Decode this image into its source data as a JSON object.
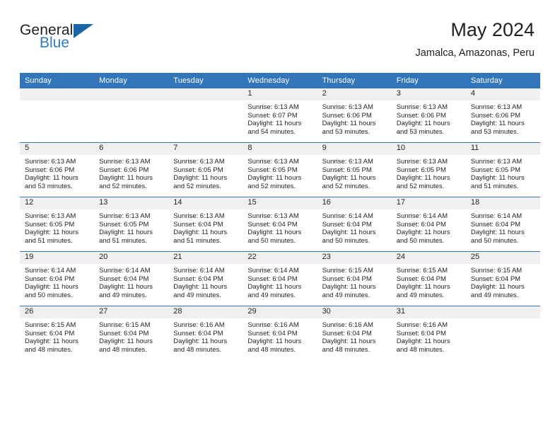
{
  "brand": {
    "word_general": "General",
    "word_blue": "Blue",
    "accent_color": "#2e7cc4",
    "triangle_color": "#1565a8"
  },
  "header": {
    "title": "May 2024",
    "subtitle": "Jamalca, Amazonas, Peru",
    "header_bg": "#3275b8",
    "daynum_band_bg": "#f0f0f0"
  },
  "weekdays": [
    "Sunday",
    "Monday",
    "Tuesday",
    "Wednesday",
    "Thursday",
    "Friday",
    "Saturday"
  ],
  "weeks": [
    [
      {
        "day": "",
        "sunrise": "",
        "sunset": "",
        "daylight1": "",
        "daylight2": ""
      },
      {
        "day": "",
        "sunrise": "",
        "sunset": "",
        "daylight1": "",
        "daylight2": ""
      },
      {
        "day": "",
        "sunrise": "",
        "sunset": "",
        "daylight1": "",
        "daylight2": ""
      },
      {
        "day": "1",
        "sunrise": "Sunrise: 6:13 AM",
        "sunset": "Sunset: 6:07 PM",
        "daylight1": "Daylight: 11 hours",
        "daylight2": "and 54 minutes."
      },
      {
        "day": "2",
        "sunrise": "Sunrise: 6:13 AM",
        "sunset": "Sunset: 6:06 PM",
        "daylight1": "Daylight: 11 hours",
        "daylight2": "and 53 minutes."
      },
      {
        "day": "3",
        "sunrise": "Sunrise: 6:13 AM",
        "sunset": "Sunset: 6:06 PM",
        "daylight1": "Daylight: 11 hours",
        "daylight2": "and 53 minutes."
      },
      {
        "day": "4",
        "sunrise": "Sunrise: 6:13 AM",
        "sunset": "Sunset: 6:06 PM",
        "daylight1": "Daylight: 11 hours",
        "daylight2": "and 53 minutes."
      }
    ],
    [
      {
        "day": "5",
        "sunrise": "Sunrise: 6:13 AM",
        "sunset": "Sunset: 6:06 PM",
        "daylight1": "Daylight: 11 hours",
        "daylight2": "and 53 minutes."
      },
      {
        "day": "6",
        "sunrise": "Sunrise: 6:13 AM",
        "sunset": "Sunset: 6:06 PM",
        "daylight1": "Daylight: 11 hours",
        "daylight2": "and 52 minutes."
      },
      {
        "day": "7",
        "sunrise": "Sunrise: 6:13 AM",
        "sunset": "Sunset: 6:05 PM",
        "daylight1": "Daylight: 11 hours",
        "daylight2": "and 52 minutes."
      },
      {
        "day": "8",
        "sunrise": "Sunrise: 6:13 AM",
        "sunset": "Sunset: 6:05 PM",
        "daylight1": "Daylight: 11 hours",
        "daylight2": "and 52 minutes."
      },
      {
        "day": "9",
        "sunrise": "Sunrise: 6:13 AM",
        "sunset": "Sunset: 6:05 PM",
        "daylight1": "Daylight: 11 hours",
        "daylight2": "and 52 minutes."
      },
      {
        "day": "10",
        "sunrise": "Sunrise: 6:13 AM",
        "sunset": "Sunset: 6:05 PM",
        "daylight1": "Daylight: 11 hours",
        "daylight2": "and 52 minutes."
      },
      {
        "day": "11",
        "sunrise": "Sunrise: 6:13 AM",
        "sunset": "Sunset: 6:05 PM",
        "daylight1": "Daylight: 11 hours",
        "daylight2": "and 51 minutes."
      }
    ],
    [
      {
        "day": "12",
        "sunrise": "Sunrise: 6:13 AM",
        "sunset": "Sunset: 6:05 PM",
        "daylight1": "Daylight: 11 hours",
        "daylight2": "and 51 minutes."
      },
      {
        "day": "13",
        "sunrise": "Sunrise: 6:13 AM",
        "sunset": "Sunset: 6:05 PM",
        "daylight1": "Daylight: 11 hours",
        "daylight2": "and 51 minutes."
      },
      {
        "day": "14",
        "sunrise": "Sunrise: 6:13 AM",
        "sunset": "Sunset: 6:04 PM",
        "daylight1": "Daylight: 11 hours",
        "daylight2": "and 51 minutes."
      },
      {
        "day": "15",
        "sunrise": "Sunrise: 6:13 AM",
        "sunset": "Sunset: 6:04 PM",
        "daylight1": "Daylight: 11 hours",
        "daylight2": "and 50 minutes."
      },
      {
        "day": "16",
        "sunrise": "Sunrise: 6:14 AM",
        "sunset": "Sunset: 6:04 PM",
        "daylight1": "Daylight: 11 hours",
        "daylight2": "and 50 minutes."
      },
      {
        "day": "17",
        "sunrise": "Sunrise: 6:14 AM",
        "sunset": "Sunset: 6:04 PM",
        "daylight1": "Daylight: 11 hours",
        "daylight2": "and 50 minutes."
      },
      {
        "day": "18",
        "sunrise": "Sunrise: 6:14 AM",
        "sunset": "Sunset: 6:04 PM",
        "daylight1": "Daylight: 11 hours",
        "daylight2": "and 50 minutes."
      }
    ],
    [
      {
        "day": "19",
        "sunrise": "Sunrise: 6:14 AM",
        "sunset": "Sunset: 6:04 PM",
        "daylight1": "Daylight: 11 hours",
        "daylight2": "and 50 minutes."
      },
      {
        "day": "20",
        "sunrise": "Sunrise: 6:14 AM",
        "sunset": "Sunset: 6:04 PM",
        "daylight1": "Daylight: 11 hours",
        "daylight2": "and 49 minutes."
      },
      {
        "day": "21",
        "sunrise": "Sunrise: 6:14 AM",
        "sunset": "Sunset: 6:04 PM",
        "daylight1": "Daylight: 11 hours",
        "daylight2": "and 49 minutes."
      },
      {
        "day": "22",
        "sunrise": "Sunrise: 6:14 AM",
        "sunset": "Sunset: 6:04 PM",
        "daylight1": "Daylight: 11 hours",
        "daylight2": "and 49 minutes."
      },
      {
        "day": "23",
        "sunrise": "Sunrise: 6:15 AM",
        "sunset": "Sunset: 6:04 PM",
        "daylight1": "Daylight: 11 hours",
        "daylight2": "and 49 minutes."
      },
      {
        "day": "24",
        "sunrise": "Sunrise: 6:15 AM",
        "sunset": "Sunset: 6:04 PM",
        "daylight1": "Daylight: 11 hours",
        "daylight2": "and 49 minutes."
      },
      {
        "day": "25",
        "sunrise": "Sunrise: 6:15 AM",
        "sunset": "Sunset: 6:04 PM",
        "daylight1": "Daylight: 11 hours",
        "daylight2": "and 49 minutes."
      }
    ],
    [
      {
        "day": "26",
        "sunrise": "Sunrise: 6:15 AM",
        "sunset": "Sunset: 6:04 PM",
        "daylight1": "Daylight: 11 hours",
        "daylight2": "and 48 minutes."
      },
      {
        "day": "27",
        "sunrise": "Sunrise: 6:15 AM",
        "sunset": "Sunset: 6:04 PM",
        "daylight1": "Daylight: 11 hours",
        "daylight2": "and 48 minutes."
      },
      {
        "day": "28",
        "sunrise": "Sunrise: 6:16 AM",
        "sunset": "Sunset: 6:04 PM",
        "daylight1": "Daylight: 11 hours",
        "daylight2": "and 48 minutes."
      },
      {
        "day": "29",
        "sunrise": "Sunrise: 6:16 AM",
        "sunset": "Sunset: 6:04 PM",
        "daylight1": "Daylight: 11 hours",
        "daylight2": "and 48 minutes."
      },
      {
        "day": "30",
        "sunrise": "Sunrise: 6:16 AM",
        "sunset": "Sunset: 6:04 PM",
        "daylight1": "Daylight: 11 hours",
        "daylight2": "and 48 minutes."
      },
      {
        "day": "31",
        "sunrise": "Sunrise: 6:16 AM",
        "sunset": "Sunset: 6:04 PM",
        "daylight1": "Daylight: 11 hours",
        "daylight2": "and 48 minutes."
      },
      {
        "day": "",
        "sunrise": "",
        "sunset": "",
        "daylight1": "",
        "daylight2": ""
      }
    ]
  ]
}
